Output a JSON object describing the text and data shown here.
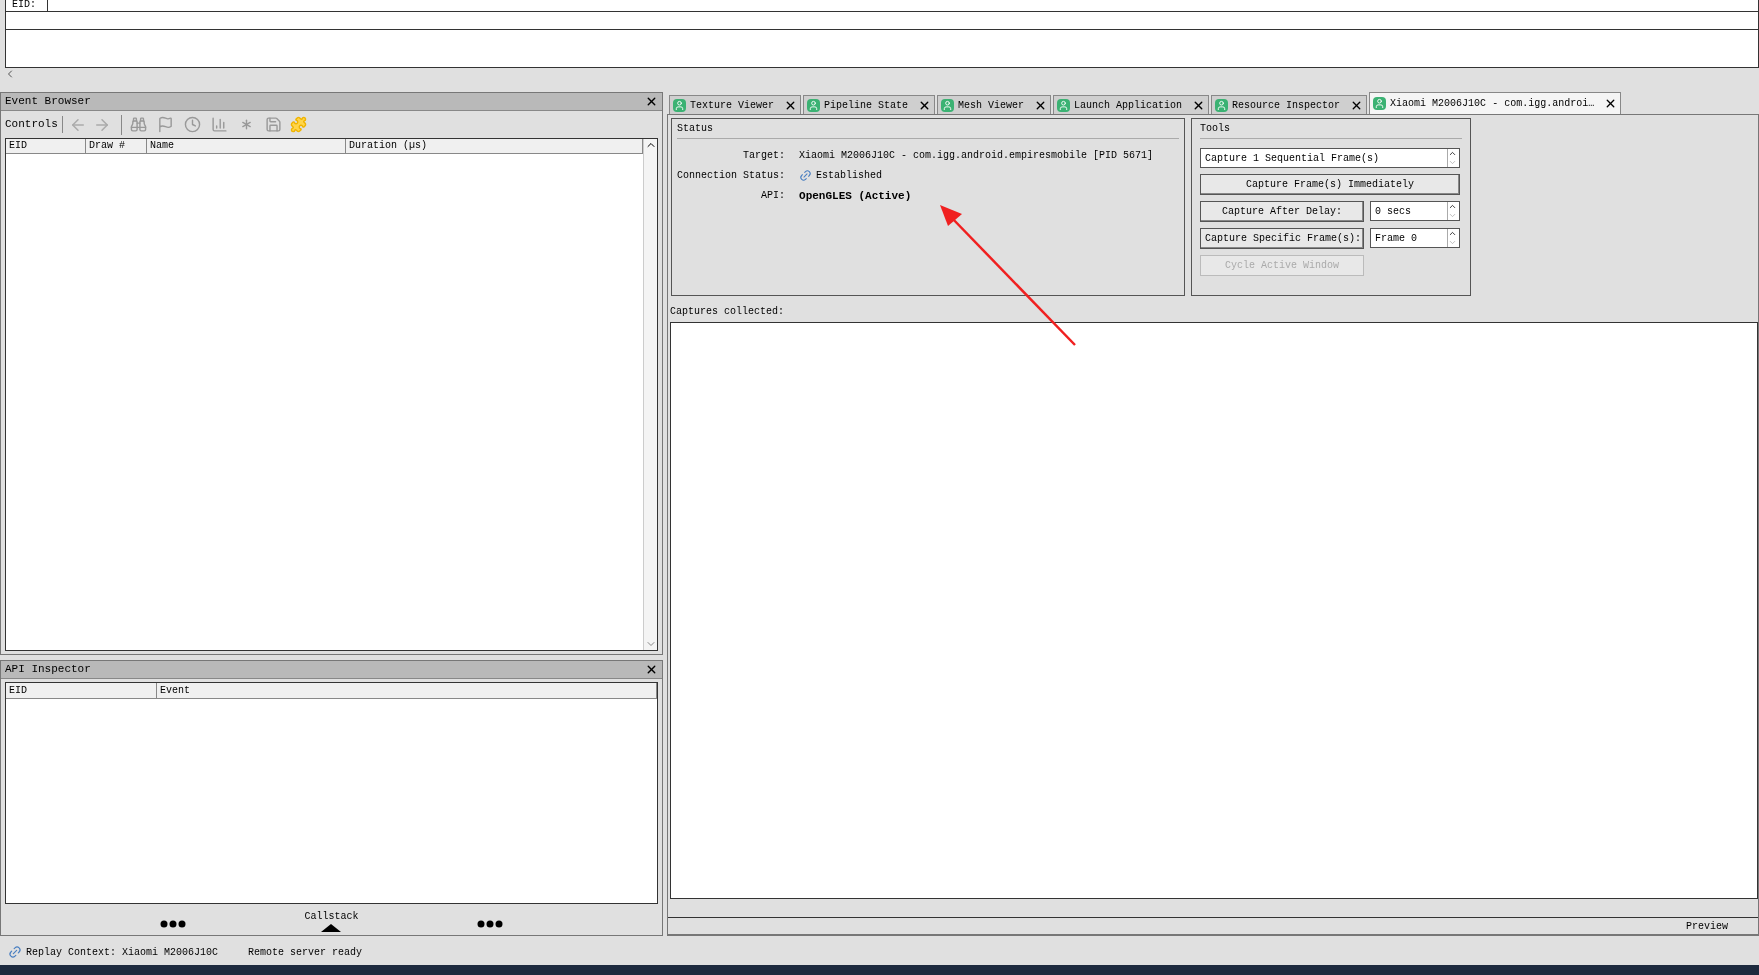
{
  "top_panel": {
    "eid_label": "EID:"
  },
  "event_browser": {
    "title": "Event Browser",
    "controls_label": "Controls",
    "columns": [
      "EID",
      "Draw #",
      "Name",
      "Duration (µs)"
    ]
  },
  "api_inspector": {
    "title": "API Inspector",
    "columns": [
      "EID",
      "Event"
    ],
    "footer_label": "Callstack"
  },
  "tabs": [
    {
      "label": "Texture Viewer",
      "selected": false
    },
    {
      "label": "Pipeline State",
      "selected": false
    },
    {
      "label": "Mesh Viewer",
      "selected": false
    },
    {
      "label": "Launch Application",
      "selected": false
    },
    {
      "label": "Resource Inspector",
      "selected": false
    },
    {
      "label": "Xiaomi M2006J10C - com.igg.androi…",
      "selected": true
    }
  ],
  "status": {
    "title": "Status",
    "fields": [
      {
        "kind": "text",
        "label": "Target:",
        "value": "Xiaomi M2006J10C - com.igg.android.empiresmobile [PID 5671]"
      },
      {
        "kind": "connection",
        "label": "Connection Status:",
        "value": "Established"
      },
      {
        "kind": "bold",
        "label": "API:",
        "value": "OpenGLES (Active)"
      }
    ]
  },
  "tools": {
    "title": "Tools",
    "items": [
      {
        "kind": "spin",
        "value": "Capture 1 Sequential Frame(s)"
      },
      {
        "kind": "button",
        "label": "Capture Frame(s) Immediately",
        "disabled": false
      },
      {
        "kind": "button_spin",
        "label": "Capture After Delay:",
        "value": "0 secs"
      },
      {
        "kind": "button_spin",
        "label": "Capture Specific Frame(s):",
        "value": "Frame 0"
      },
      {
        "kind": "small_button",
        "label": "Cycle Active Window",
        "disabled": true
      }
    ]
  },
  "captures": {
    "label": "Captures collected:"
  },
  "preview": {
    "label": "Preview"
  },
  "status_bar": {
    "replay_context": "Replay Context: Xiaomi M2006J10C",
    "server_status": "Remote server ready"
  }
}
